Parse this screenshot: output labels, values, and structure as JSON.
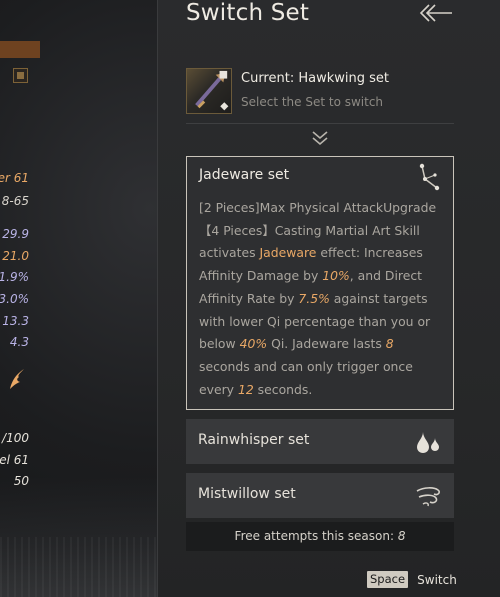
{
  "background": {
    "stats": [
      {
        "text": "er 61",
        "color": "#e9a866"
      },
      {
        "text": "8-65",
        "color": "#d8d4cc"
      },
      {
        "text": "29.9",
        "color": "#b9b3e6"
      },
      {
        "text": "21.0",
        "color": "#e9a866"
      },
      {
        "text": "1.9%",
        "color": "#b9b3e6"
      },
      {
        "text": "3.0%",
        "color": "#b9b3e6"
      },
      {
        "text": "13.3",
        "color": "#b9b3e6"
      },
      {
        "text": "4.3",
        "color": "#b9b3e6"
      },
      {
        "text": "/100",
        "color": "#e6e2da"
      },
      {
        "text": "el 61",
        "color": "#e6e2da"
      },
      {
        "text": "50",
        "color": "#e6e2da"
      }
    ]
  },
  "panel": {
    "title": "Switch Set",
    "current": {
      "title": "Current: Hawkwing set",
      "subtitle": "Select the Set to switch"
    },
    "selected_set": {
      "name": "Jadeware set",
      "desc": [
        {
          "t": "[2 Pieces]Max Physical AttackUpgrade",
          "s": ""
        },
        {
          "t": " 【4 Pieces】Casting Martial Art Skill activates ",
          "s": ""
        },
        {
          "t": "Jadeware",
          "s": "em"
        },
        {
          "t": " effect: Increases Affinity Damage by ",
          "s": ""
        },
        {
          "t": "10%",
          "s": "num"
        },
        {
          "t": ", and Direct Affinity Rate by ",
          "s": ""
        },
        {
          "t": "7.5%",
          "s": "num"
        },
        {
          "t": " against targets with lower Qi percentage than you or below ",
          "s": ""
        },
        {
          "t": "40%",
          "s": "num"
        },
        {
          "t": " Qi. Jadeware lasts ",
          "s": ""
        },
        {
          "t": "8",
          "s": "num"
        },
        {
          "t": " seconds and can only trigger once every ",
          "s": ""
        },
        {
          "t": "12",
          "s": "num"
        },
        {
          "t": " seconds.",
          "s": ""
        }
      ]
    },
    "sets": [
      {
        "name": "Rainwhisper set",
        "icon": "water-drops-icon"
      },
      {
        "name": "Mistwillow set",
        "icon": "wind-swirl-icon"
      }
    ],
    "free_attempts": {
      "label": "Free attempts this season: ",
      "value": "8"
    },
    "hint": {
      "key": "Space",
      "label": "Switch"
    }
  },
  "colors": {
    "accent": "#e9a866",
    "stat_purple": "#b9b3e6",
    "panel_bg": "#2a2b2d",
    "selected_border": "#c9c4ba"
  }
}
